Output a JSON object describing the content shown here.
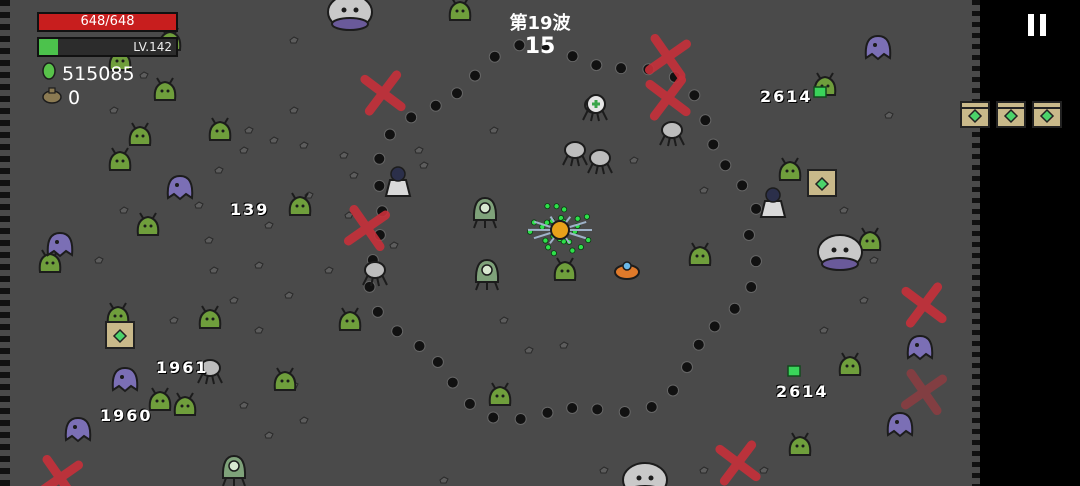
{
  "hud": {
    "hp_text": "648/648",
    "hp_fraction": 1.0,
    "level_text": "LV.142",
    "xp_fraction": 0.14,
    "gems": "515085",
    "bag": "0"
  },
  "wave": {
    "label": "第19波",
    "countdown": "15"
  },
  "damage_numbers": {
    "d1": "2614",
    "d2": "139",
    "d3": "1961",
    "d4": "1960",
    "d5": "2614"
  },
  "colors": {
    "arena": "#4a4a4a",
    "hp": "#c81e1e",
    "xp": "#4cc24c",
    "enemy_green": "#6f9e3c",
    "enemy_purple": "#7b6fb5",
    "marker_red": "#c7303a"
  },
  "icons": {
    "gem": "green-gem-icon",
    "bag": "coin-bag-icon",
    "pause": "pause-icon",
    "crate": "supply-crate-icon"
  }
}
